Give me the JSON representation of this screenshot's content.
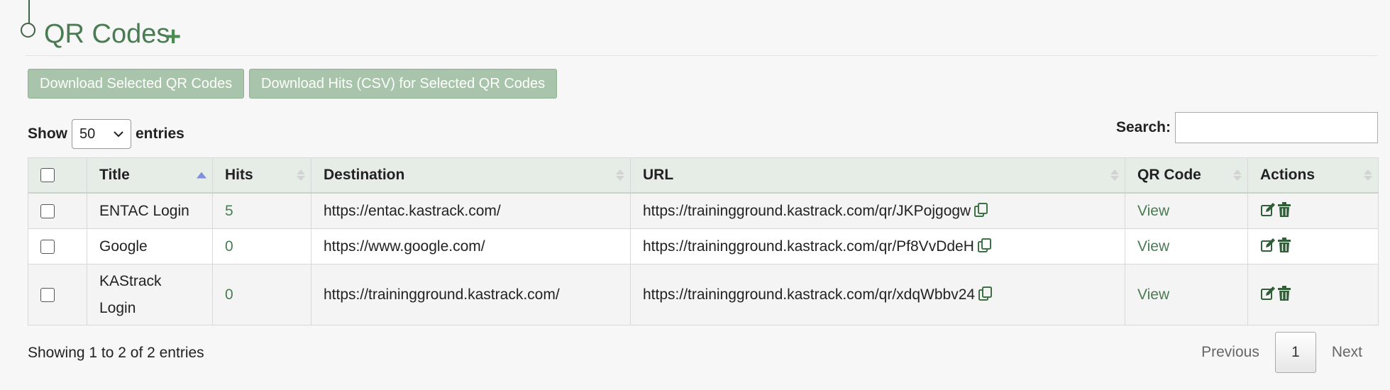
{
  "page": {
    "title": "QR Codes",
    "add_symbol": "+"
  },
  "toolbar": {
    "download_qr_label": "Download Selected QR Codes",
    "download_hits_label": "Download Hits (CSV) for Selected QR Codes"
  },
  "length": {
    "show_label": "Show",
    "value": "50",
    "entries_label": "entries"
  },
  "search": {
    "label": "Search:",
    "value": ""
  },
  "table": {
    "columns": [
      "Title",
      "Hits",
      "Destination",
      "URL",
      "QR Code",
      "Actions"
    ],
    "sorted_column": "Title",
    "rows": [
      {
        "title": "ENTAC Login",
        "hits": "5",
        "destination": "https://entac.kastrack.com/",
        "url": "https://trainingground.kastrack.com/qr/JKPojgogw",
        "qr": "View"
      },
      {
        "title": "Google",
        "hits": "0",
        "destination": "https://www.google.com/",
        "url": "https://trainingground.kastrack.com/qr/Pf8VvDdeH",
        "qr": "View"
      },
      {
        "title": "KAStrack Login",
        "hits": "0",
        "destination": "https://trainingground.kastrack.com/",
        "url": "https://trainingground.kastrack.com/qr/xdqWbbv24",
        "qr": "View"
      }
    ]
  },
  "footer": {
    "info": "Showing 1 to 2 of 2 entries"
  },
  "pagination": {
    "previous": "Previous",
    "current": "1",
    "next": "Next"
  },
  "colors": {
    "accent": "#4a7c54",
    "button_bg": "#a8c4aa",
    "header_bg": "#e6ece6",
    "sort_active": "#7f8ee0"
  },
  "icons": {
    "add": "plus-icon",
    "copy": "copy-icon",
    "edit": "edit-icon",
    "delete": "trash-icon",
    "select": "chevron-down-icon"
  }
}
